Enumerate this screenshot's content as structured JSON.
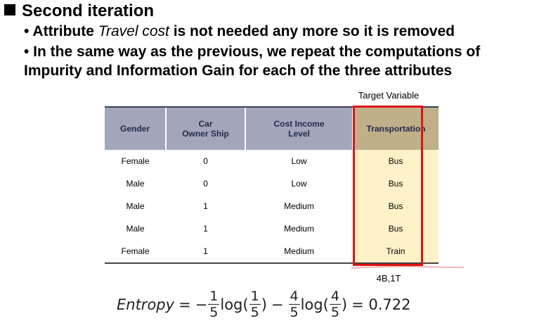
{
  "slide": {
    "heading": "Second iteration",
    "bullet1": {
      "pre": "• Attribute ",
      "emph": "Travel cost",
      "post": " is not needed any more so it is removed"
    },
    "bullet2": "• In the same way as the previous, we repeat the computations of",
    "bullet3": "Impurity and Information Gain for each of the three attributes",
    "target_label": "Target Variable",
    "result_label": "4B,1T"
  },
  "table": {
    "headers": [
      "Gender",
      "Car\nOwner Ship",
      "Cost Income\nLevel",
      "Transportation"
    ],
    "rows": [
      [
        "Female",
        "0",
        "Low",
        "Bus"
      ],
      [
        "Male",
        "0",
        "Low",
        "Bus"
      ],
      [
        "Male",
        "1",
        "Medium",
        "Bus"
      ],
      [
        "Male",
        "1",
        "Medium",
        "Bus"
      ],
      [
        "Female",
        "1",
        "Medium",
        "Train"
      ]
    ]
  },
  "formula": {
    "lhs": "Entropy",
    "eq": "=",
    "minus": "−",
    "log": "log(",
    "close": ")",
    "num1": "1",
    "den1": "5",
    "num2": "4",
    "den2": "5",
    "result": "= 0.722"
  },
  "colors": {
    "highlight": "#e01212",
    "header_bg": "#a3a6ba",
    "target_header_bg": "#bfb08a",
    "target_cell_bg": "#fff1c7"
  }
}
